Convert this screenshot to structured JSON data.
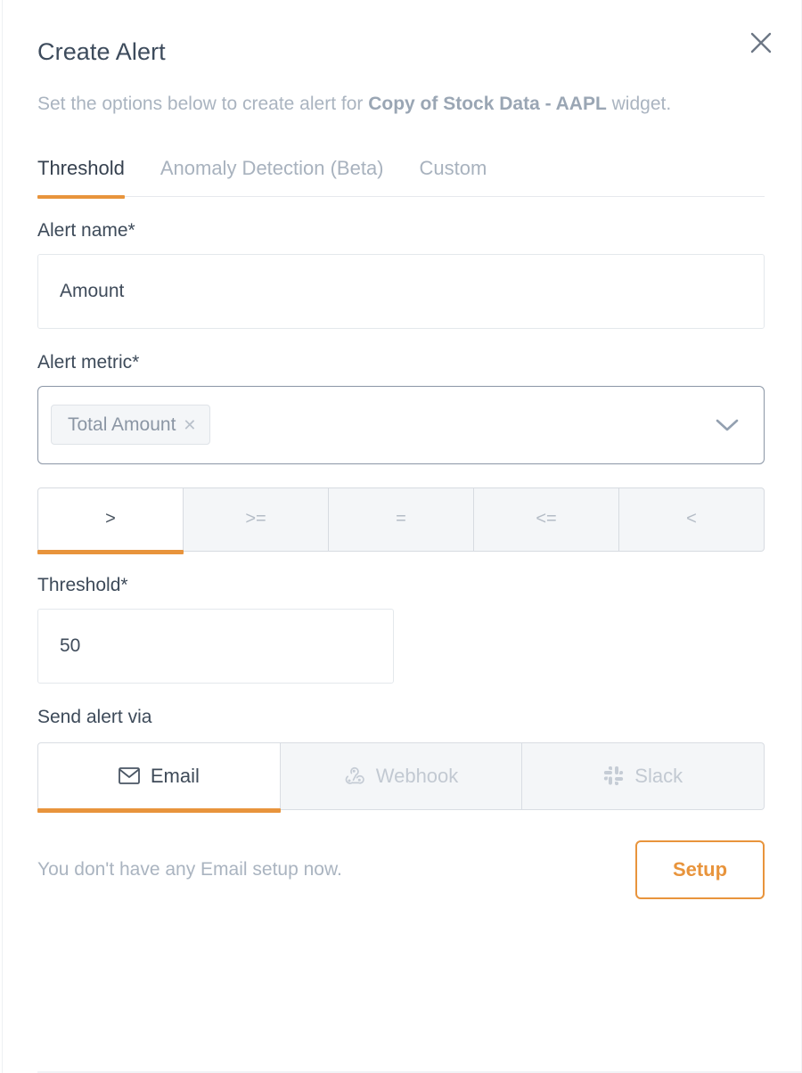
{
  "modal": {
    "title": "Create Alert",
    "close_icon": "close-icon",
    "subtitle": {
      "prefix": "Set the options below to create alert for ",
      "widget_name": "Copy of Stock Data - AAPL",
      "suffix": " widget."
    }
  },
  "tabs": [
    {
      "label": "Threshold",
      "active": true
    },
    {
      "label": "Anomaly Detection (Beta)",
      "active": false
    },
    {
      "label": "Custom",
      "active": false
    }
  ],
  "form": {
    "alert_name": {
      "label": "Alert name*",
      "value": "Amount",
      "placeholder": "Amount"
    },
    "alert_metric": {
      "label": "Alert metric*",
      "chips": [
        {
          "label": "Total Amount",
          "remove_icon": "close-small-icon"
        }
      ],
      "caret_icon": "chevron-down-icon"
    },
    "operators": [
      {
        "label": ">",
        "active": true
      },
      {
        "label": ">=",
        "active": false
      },
      {
        "label": "=",
        "active": false
      },
      {
        "label": "<=",
        "active": false
      },
      {
        "label": "<",
        "active": false
      }
    ],
    "threshold": {
      "label": "Threshold*",
      "value": "50",
      "placeholder": "50"
    },
    "send_alert_via": {
      "label": "Send alert via",
      "channels": [
        {
          "label": "Email",
          "icon": "envelope-icon",
          "active": true
        },
        {
          "label": "Webhook",
          "icon": "webhook-icon",
          "active": false
        },
        {
          "label": "Slack",
          "icon": "slack-icon",
          "active": false
        }
      ]
    }
  },
  "footer": {
    "note": "You don't have any Email setup now.",
    "setup_label": "Setup"
  },
  "colors": {
    "accent": "#e8943c",
    "text_primary": "#3d4a59",
    "text_muted": "#aab4c0",
    "border": "#e4e8ec",
    "segment_bg": "#f4f6f8"
  }
}
